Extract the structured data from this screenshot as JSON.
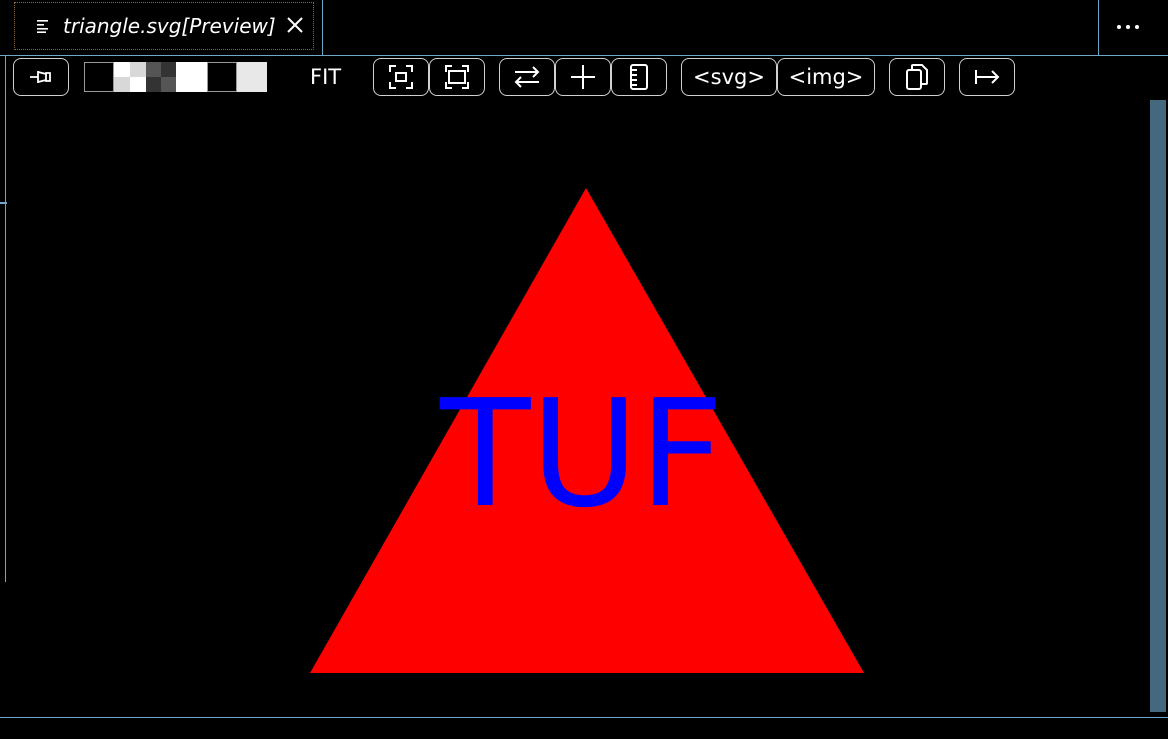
{
  "tab": {
    "title": "triangle.svg[Preview]",
    "icon": "preview-lines-icon",
    "close_icon": "close-icon"
  },
  "header": {
    "more_icon": "more-actions-icon"
  },
  "toolbar": {
    "pin_icon": "pin-icon",
    "background_swatches": [
      "#000000",
      "checker-light",
      "checker-dark",
      "#ffffff",
      "#000000",
      "#e8e8e8"
    ],
    "fit_label": "FIT",
    "fit_icon": "fit-to-frame-icon",
    "expand_icon": "expand-frame-icon",
    "swap_icon": "swap-arrows-icon",
    "crosshair_icon": "plus-crosshair-icon",
    "ruler_icon": "ruler-icon",
    "svg_label": "<svg>",
    "img_label": "<img>",
    "copy_icon": "copy-icon",
    "export_icon": "arrow-to-right-icon"
  },
  "preview": {
    "text": "TUF",
    "triangle_color": "#ff0000",
    "text_color": "#0000ff",
    "background": "#000000"
  },
  "colors": {
    "accent_border": "#6fa8c9",
    "scrollbar": "#44687d"
  }
}
